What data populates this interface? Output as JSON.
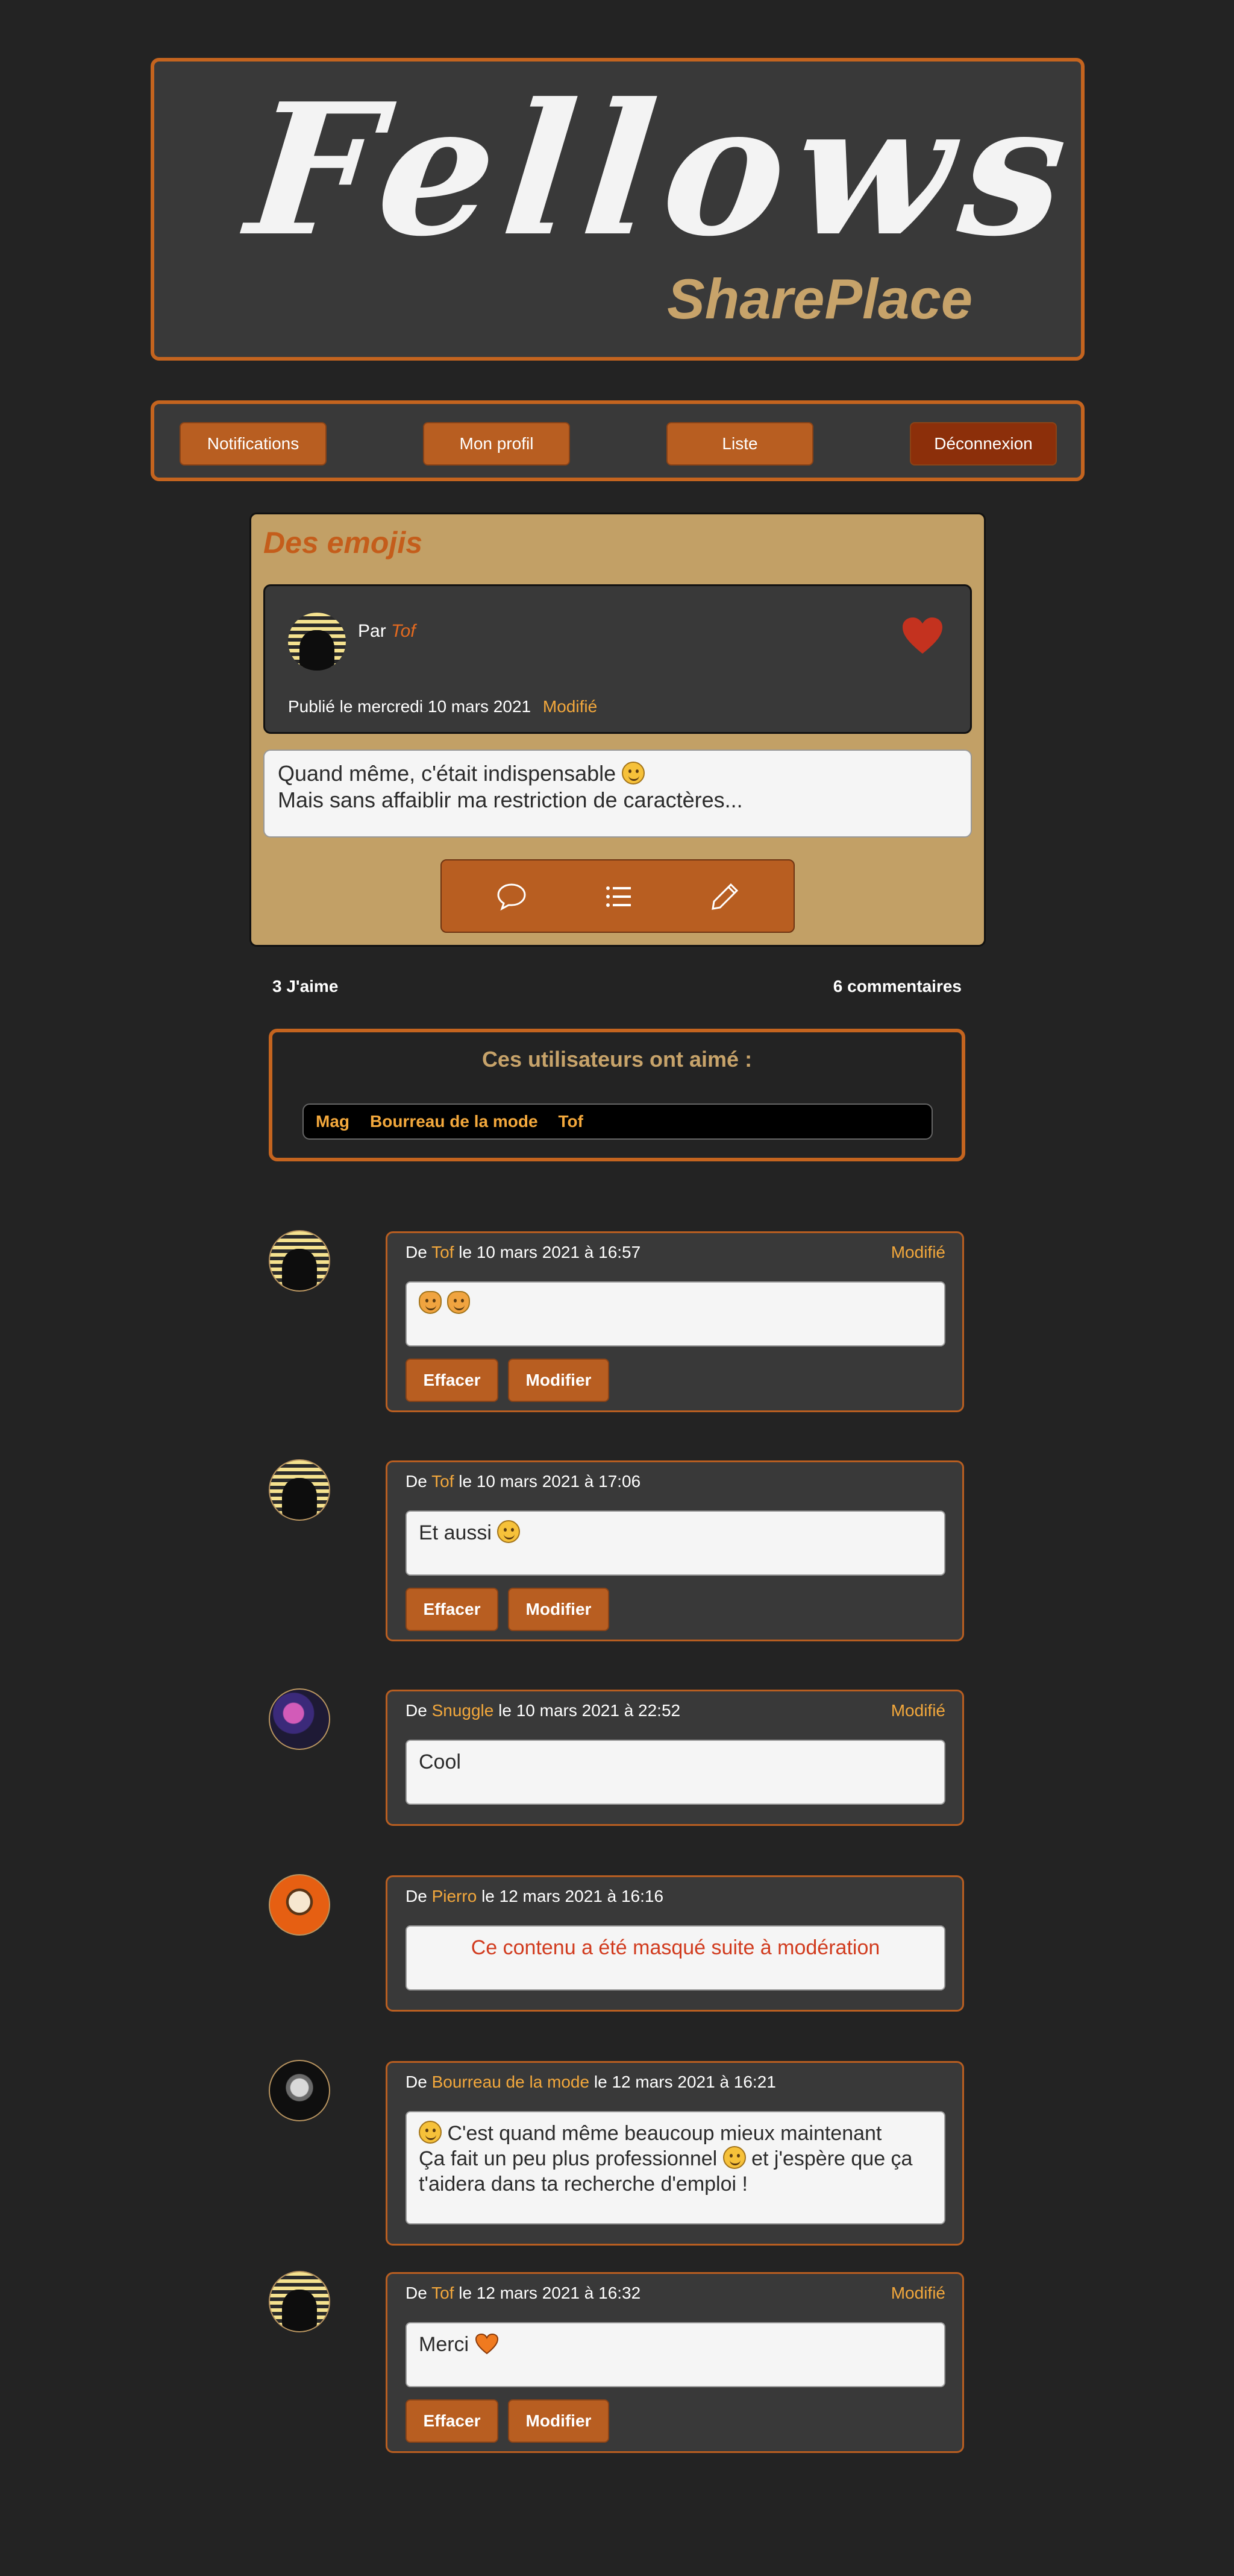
{
  "brand": {
    "title": "Fellows",
    "subtitle": "SharePlace"
  },
  "nav": {
    "notifications": "Notifications",
    "profile": "Mon profil",
    "list": "Liste",
    "logout": "Déconnexion"
  },
  "post": {
    "title": "Des emojis",
    "by_prefix": "Par",
    "author": "Tof",
    "published": "Publié le mercredi 10 mars 2021",
    "modified": "Modifié",
    "line1": "Quand même, c'était indispensable",
    "line2": "Mais sans affaiblir ma restriction de caractères...",
    "icons": [
      "comment-icon",
      "list-icon",
      "pencil-icon"
    ]
  },
  "stats": {
    "likes": "3 J'aime",
    "comments": "6 commentaires"
  },
  "likes": {
    "title": "Ces utilisateurs ont aimé :",
    "users": [
      "Mag",
      "Bourreau de la mode",
      "Tof"
    ]
  },
  "comments": [
    {
      "from": "De",
      "author": "Tof",
      "date": "le 10 mars 2021 à 16:57",
      "modified": "Modifié",
      "text": "",
      "erase": "Effacer",
      "edit": "Modifier"
    },
    {
      "from": "De",
      "author": "Tof",
      "date": "le 10 mars 2021 à 17:06",
      "modified": "",
      "text": "Et aussi",
      "erase": "Effacer",
      "edit": "Modifier"
    },
    {
      "from": "De",
      "author": "Snuggle",
      "date": "le 10 mars 2021 à 22:52",
      "modified": "Modifié",
      "text": "Cool"
    },
    {
      "from": "De",
      "author": "Pierro",
      "date": "le 12 mars 2021 à 16:16",
      "modified": "",
      "text": "Ce contenu a été masqué suite à modération"
    },
    {
      "from": "De",
      "author": "Bourreau de la mode",
      "date": "le 12 mars 2021 à 16:21",
      "modified": "",
      "text1": "C'est quand même beaucoup mieux maintenant",
      "text2a": "Ça fait un peu plus professionnel",
      "text2b": "et j'espère que ça",
      "text3": "t'aidera dans ta recherche d'emploi !"
    },
    {
      "from": "De",
      "author": "Tof",
      "date": "le 12 mars 2021 à 16:32",
      "modified": "Modifié",
      "text": "Merci",
      "erase": "Effacer",
      "edit": "Modifier"
    }
  ],
  "colors": {
    "accent": "#c4641f",
    "button": "#b85e21",
    "gold": "#c2a066",
    "highlight": "#f3a83c",
    "background": "#232323"
  }
}
